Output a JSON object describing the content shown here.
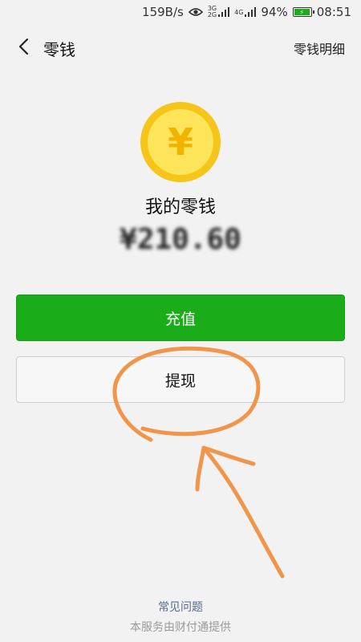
{
  "status_bar": {
    "speed": "159B/s",
    "eye_icon": "eye-icon",
    "signal1": "3G\n2G",
    "signal2": "4G",
    "battery": "94%",
    "time": "08:51"
  },
  "nav": {
    "back_icon": "chevron-left-icon",
    "title": "零钱",
    "action": "零钱明细"
  },
  "wallet": {
    "icon": "yuan-coin-icon",
    "coin_symbol": "¥",
    "label": "我的零钱",
    "amount": "¥210.60"
  },
  "buttons": {
    "recharge": "充值",
    "withdraw": "提现"
  },
  "footer": {
    "faq": "常见问题",
    "note": "本服务由财付通提供"
  },
  "colors": {
    "primary_green": "#1aad19",
    "coin_outer": "#f6c51a",
    "coin_inner": "#fde45a",
    "link_blue": "#576b95",
    "annotation_orange": "#f0954a"
  }
}
